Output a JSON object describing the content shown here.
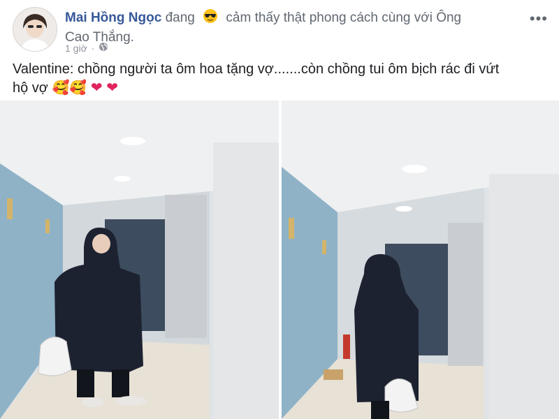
{
  "post": {
    "author": "Mai Hồng Ngọc",
    "verb": "đang",
    "feeling_emoji": "sunglasses-emoji",
    "feeling_text_line1": "cảm thấy thật phong cách cùng với Ông",
    "feeling_text_line2": "Cao Thắng.",
    "timestamp": "1 giờ",
    "separator": "·",
    "privacy": "globe-icon",
    "text_line1": "Valentine: chồng người ta ôm hoa tặng vợ.......còn chồng tui ôm bịch rác đi vứt",
    "text_line2": "hộ vợ",
    "text_emojis": [
      "🥰",
      "🥰",
      "❤",
      "❤"
    ],
    "more_label": "•••"
  },
  "colors": {
    "author": "#365899",
    "meta": "#90949c",
    "heart": "#e0245e",
    "wall": "#d8dde0",
    "door": "#3d4c5e",
    "coat": "#1c2230"
  },
  "photos": [
    {
      "name": "photo-left",
      "subject": "man in long black padded coat holding phone and trash bag"
    },
    {
      "name": "photo-right",
      "subject": "man in long black padded coat, side view, holding trash bag"
    }
  ]
}
